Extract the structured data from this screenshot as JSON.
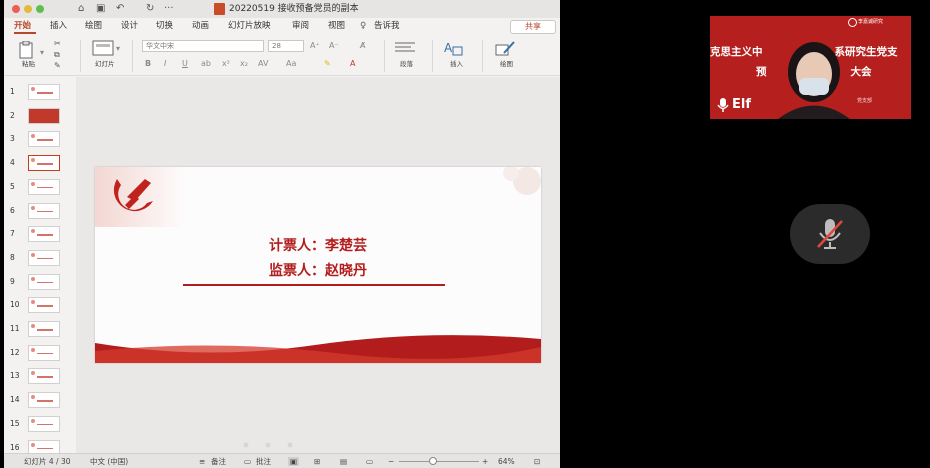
{
  "window": {
    "title": "20220519 接收预备党员的副本",
    "share_label": "共享"
  },
  "tabs": [
    "开始",
    "插入",
    "绘图",
    "设计",
    "切换",
    "动画",
    "幻灯片放映",
    "审阅",
    "视图"
  ],
  "tell_me": "告诉我",
  "ribbon": {
    "paste_label": "粘贴",
    "slides_label": "幻灯片",
    "font_name": "华文中宋",
    "font_size": "28",
    "paragraph_label": "段落",
    "insert_label": "插入",
    "drawing_label": "绘图"
  },
  "thumbnails": {
    "numbers": [
      "1",
      "2",
      "3",
      "4",
      "5",
      "6",
      "7",
      "8",
      "9",
      "10",
      "11",
      "12",
      "13",
      "14",
      "15",
      "16"
    ],
    "selected": "4"
  },
  "slide": {
    "line1": "计票人：李楚芸",
    "line2": "监票人：赵晓丹"
  },
  "status": {
    "slide_counter": "幻灯片 4 / 30",
    "language": "中文 (中国)",
    "notes_label": "备注",
    "comments_label": "批注",
    "zoom_minus": "−",
    "zoom_plus": "+",
    "zoom_level": "64%"
  },
  "video": {
    "banner_line1": "克思主义中",
    "banner_line1b": "系研究生党支",
    "banner_line2": "预",
    "banner_line2b": "大会",
    "name": "Elf",
    "uni_label": "李嘉诚研究",
    "dept_label": "党支部"
  },
  "colors": {
    "accent": "#b7472a",
    "party_red": "#b31c1c",
    "banner_red": "#b5201f"
  }
}
